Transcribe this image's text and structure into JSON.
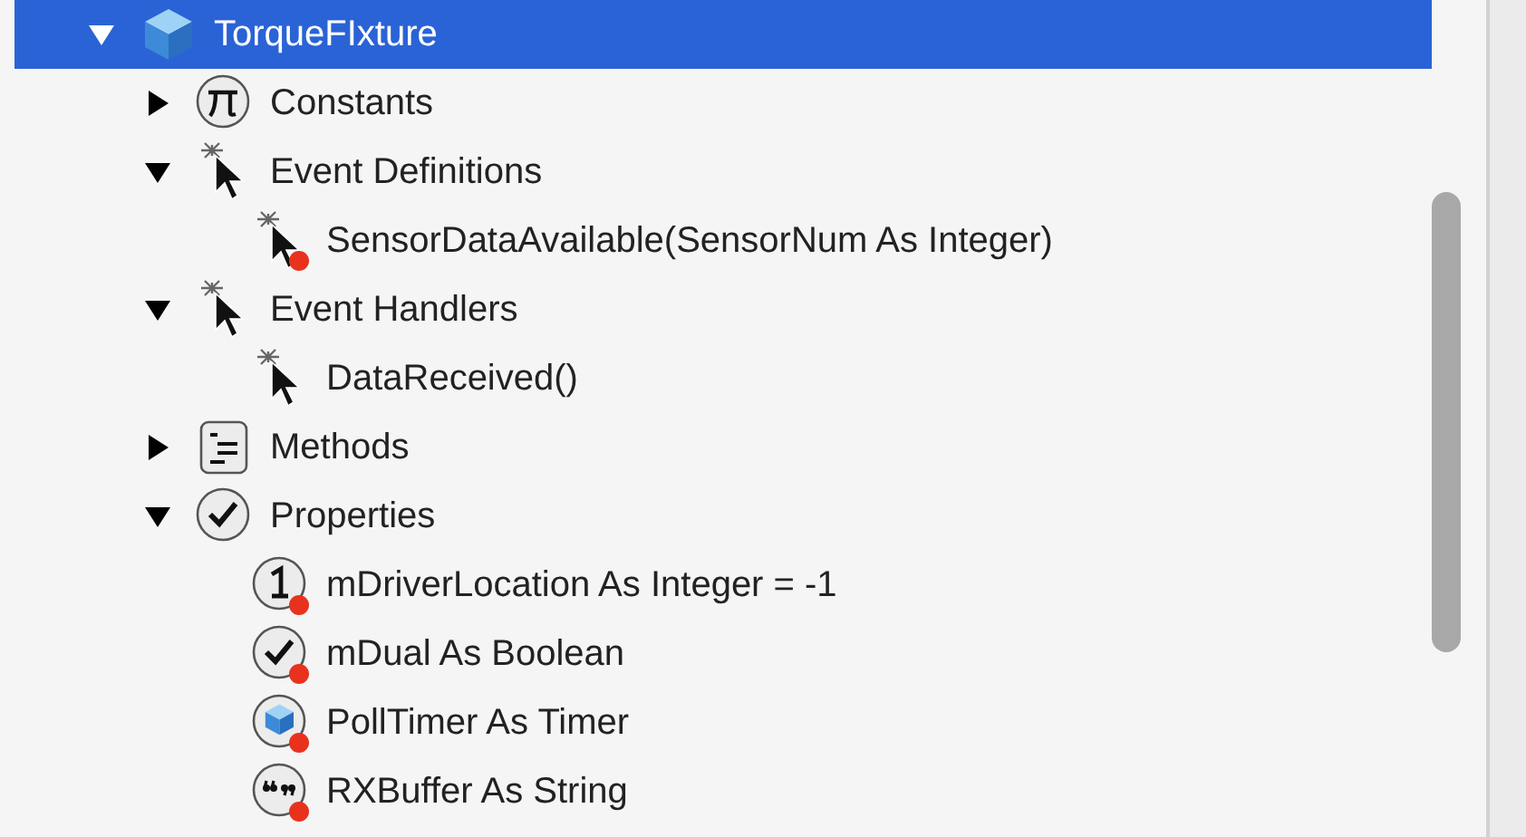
{
  "tree": [
    {
      "label": "TorqueFIxture",
      "kind": "cube",
      "selected": true,
      "expanded": true,
      "children": [
        {
          "label": "Constants",
          "kind": "pi",
          "selected": false,
          "expanded": false
        },
        {
          "label": "Event Definitions",
          "kind": "event",
          "selected": false,
          "expanded": true,
          "children": [
            {
              "label": "SensorDataAvailable(SensorNum As Integer)",
              "kind": "event",
              "selected": false,
              "flagged": true
            }
          ]
        },
        {
          "label": "Event Handlers",
          "kind": "event",
          "selected": false,
          "expanded": true,
          "children": [
            {
              "label": "DataReceived()",
              "kind": "event",
              "selected": false,
              "flagged": false
            }
          ]
        },
        {
          "label": "Methods",
          "kind": "method",
          "selected": false,
          "expanded": false
        },
        {
          "label": "Properties",
          "kind": "check",
          "selected": false,
          "expanded": true,
          "children": [
            {
              "label": "mDriverLocation As Integer = -1",
              "kind": "integer",
              "selected": false,
              "flagged": true
            },
            {
              "label": "mDual As Boolean",
              "kind": "boolean",
              "selected": false,
              "flagged": true
            },
            {
              "label": "PollTimer As Timer",
              "kind": "object",
              "selected": false,
              "flagged": true
            },
            {
              "label": "RXBuffer As String",
              "kind": "string",
              "selected": false,
              "flagged": true
            }
          ]
        }
      ]
    }
  ]
}
